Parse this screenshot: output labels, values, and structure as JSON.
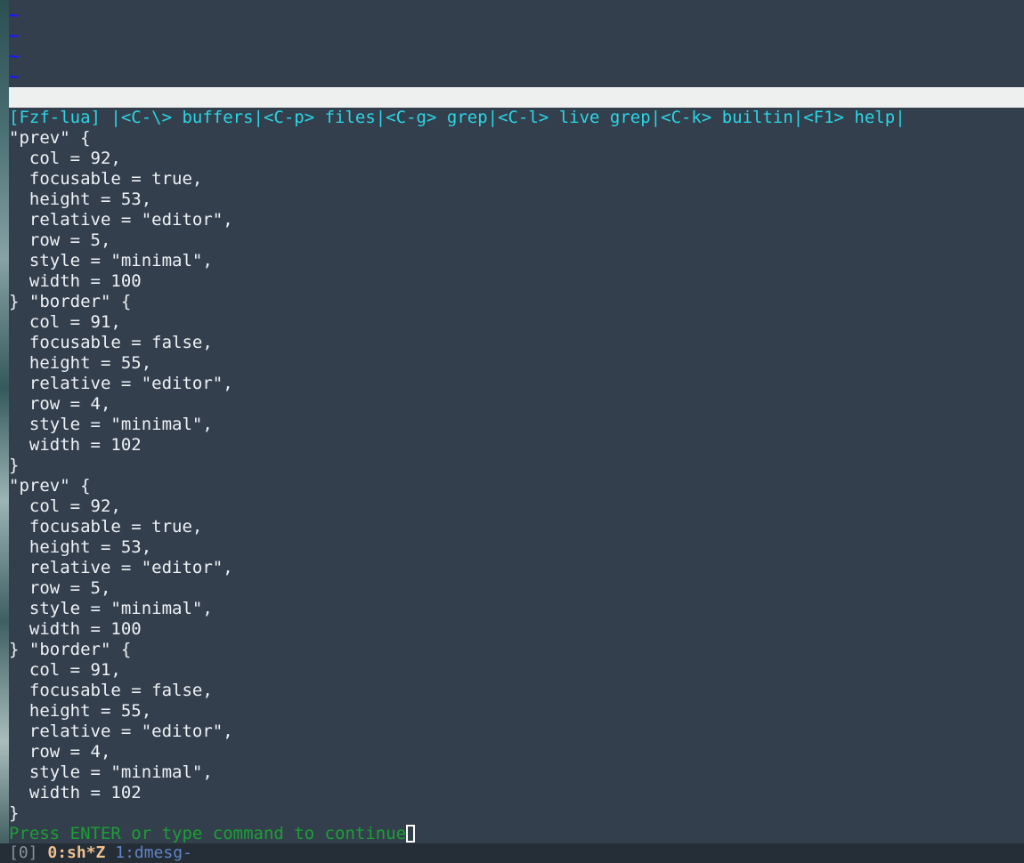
{
  "tilde_lines": [
    "~",
    "~",
    "~",
    "~"
  ],
  "fzf_header": "[Fzf-lua] |<C-\\> buffers|<C-p> files|<C-g> grep|<C-l> live grep|<C-k> builtin|<F1> help|",
  "output_lines": [
    "\"prev\" {",
    "  col = 92,",
    "  focusable = true,",
    "  height = 53,",
    "  relative = \"editor\",",
    "  row = 5,",
    "  style = \"minimal\",",
    "  width = 100",
    "} \"border\" {",
    "  col = 91,",
    "  focusable = false,",
    "  height = 55,",
    "  relative = \"editor\",",
    "  row = 4,",
    "  style = \"minimal\",",
    "  width = 102",
    "}",
    "\"prev\" {",
    "  col = 92,",
    "  focusable = true,",
    "  height = 53,",
    "  relative = \"editor\",",
    "  row = 5,",
    "  style = \"minimal\",",
    "  width = 100",
    "} \"border\" {",
    "  col = 91,",
    "  focusable = false,",
    "  height = 55,",
    "  relative = \"editor\",",
    "  row = 4,",
    "  style = \"minimal\",",
    "  width = 102",
    "}"
  ],
  "press_enter_prompt": "Press ENTER or type command to continue",
  "tmux_status": {
    "session": "[0]",
    "active_window": "0:sh*Z",
    "inactive_window": "1:dmesg-"
  },
  "colors": {
    "background": "#343f4d",
    "fzf_header": "#2ad6e6",
    "prompt": "#1aa032",
    "tilde": "#1a1aff",
    "status_active": "#f0c090",
    "status_inactive": "#5f86c6"
  }
}
